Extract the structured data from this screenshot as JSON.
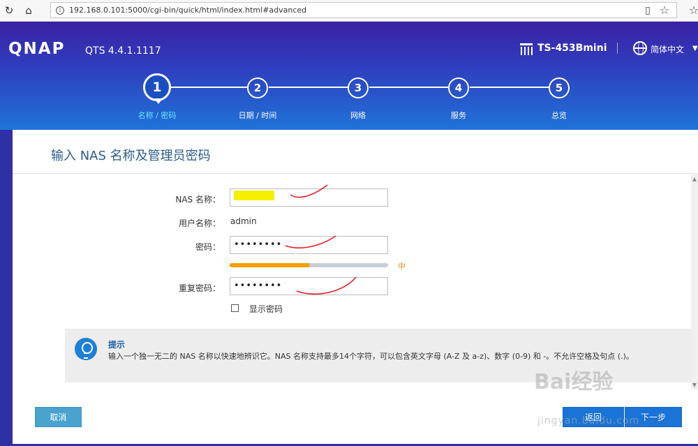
{
  "browser": {
    "url": "192.168.0.101:5000/cgi-bin/quick/html/index.html#advanced"
  },
  "header": {
    "logo": "QNAP",
    "version": "QTS 4.4.1.1117",
    "device": "TS-453Bmini",
    "language": "简体中文"
  },
  "steps": [
    {
      "num": "1",
      "label": "名称 / 密码"
    },
    {
      "num": "2",
      "label": "日期 / 时间"
    },
    {
      "num": "3",
      "label": "网络"
    },
    {
      "num": "4",
      "label": "服务"
    },
    {
      "num": "5",
      "label": "总览"
    }
  ],
  "panel": {
    "title": "输入 NAS 名称及管理员密码",
    "nas_name_label": "NAS 名称：",
    "nas_name_value": "",
    "username_label": "用户名称：",
    "username_value": "admin",
    "password_label": "密码：",
    "password_value": "••••••••",
    "strength": 0.5,
    "strength_label": "中",
    "confirm_label": "重复密码：",
    "confirm_value": "••••••••",
    "show_password_label": "显示密码"
  },
  "hint": {
    "title": "提示",
    "text": "输入一个独一无二的 NAS 名称以快速地辨识它。NAS 名称支持最多14个字符，可以包含英文字母 (A-Z 及 a-z)、数字 (0-9) 和 -。不允许空格及句点 (.)。"
  },
  "buttons": {
    "cancel": "取消",
    "back": "返回",
    "next": "下一步"
  },
  "watermark": {
    "main": "Bai经验",
    "sub": "jingyan.baidu.com"
  },
  "colors": {
    "strength_fill": "#f5a100",
    "accent": "#1a73d6",
    "annotation": "#e02020"
  }
}
